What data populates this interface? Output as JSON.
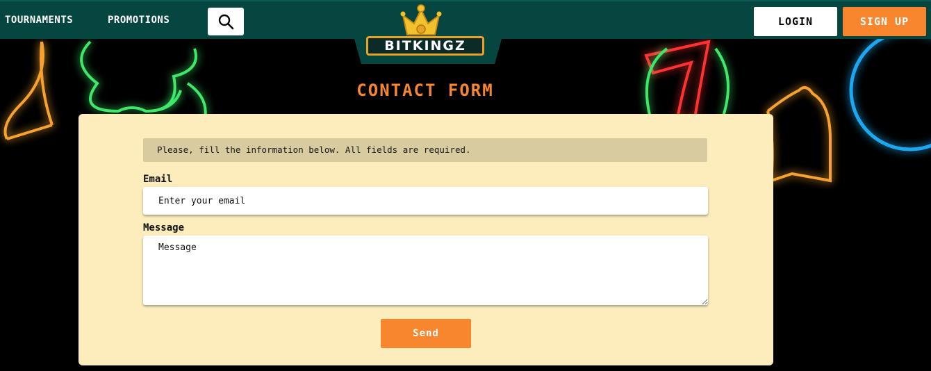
{
  "header": {
    "nav_items": [
      {
        "label": "TOURNAMENTS"
      },
      {
        "label": "PROMOTIONS"
      }
    ],
    "search_icon": "search-icon",
    "logo_text": "BITKINGZ",
    "login_label": "LOGIN",
    "signup_label": "SIGN UP"
  },
  "page": {
    "title": "CONTACT FORM"
  },
  "form": {
    "notice": "Please, fill the information below. All fields are required.",
    "email_label": "Email",
    "email_placeholder": "Enter your email",
    "email_value": "",
    "message_label": "Message",
    "message_placeholder": "Message",
    "message_value": "",
    "send_label": "Send"
  },
  "colors": {
    "header_bg": "#064640",
    "accent_orange": "#f7862e",
    "card_bg": "#fdedbd",
    "notice_bg": "#d7cb9f"
  }
}
